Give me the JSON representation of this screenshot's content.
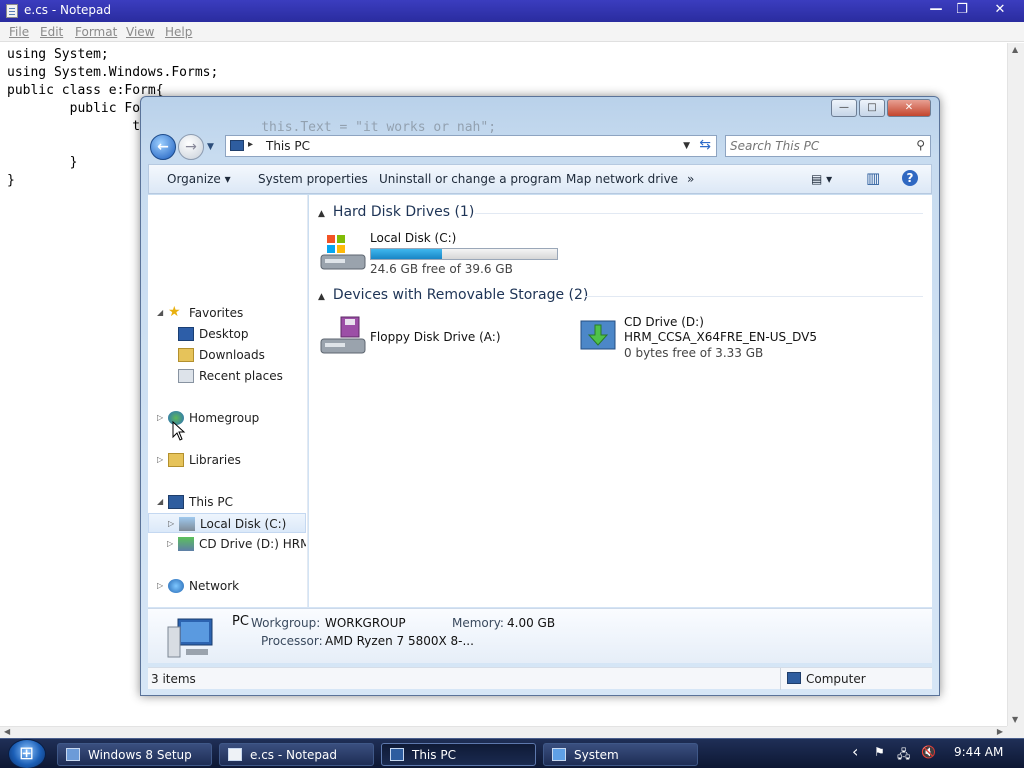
{
  "notepad": {
    "title": "e.cs - Notepad",
    "menu": [
      "File",
      "Edit",
      "Format",
      "View",
      "Help"
    ],
    "code": [
      "using System;",
      "using System.Windows.Forms;",
      "public class e:Form{",
      "        public Form1(){",
      "                this.Text = \"it works or nah\";",
      "",
      "        }",
      "}"
    ],
    "controls": {
      "minimize": "—",
      "maximize": "❐",
      "close": "✕"
    }
  },
  "explorer": {
    "controls": {
      "minimize": "—",
      "maximize": "□",
      "close": "✕"
    },
    "back": "←",
    "forward": "→",
    "address": {
      "separator": "▸",
      "path": "This PC",
      "dropdown": "▼",
      "refresh": "⇆"
    },
    "search": {
      "placeholder": "Search This PC",
      "icon": "⚲"
    },
    "toolbar": {
      "organize": "Organize ▾",
      "system_properties": "System properties",
      "uninstall": "Uninstall or change a program",
      "map_drive": "Map network drive",
      "more": "»",
      "views": "▤ ▾",
      "pane": "▥",
      "help": "?"
    },
    "nav": {
      "favorites": "Favorites",
      "desktop": "Desktop",
      "downloads": "Downloads",
      "recent": "Recent places",
      "homegroup": "Homegroup",
      "libraries": "Libraries",
      "this_pc": "This PC",
      "local_disk": "Local Disk (C:)",
      "cd_drive": "CD Drive (D:) HRM_C",
      "network": "Network",
      "expanded_arrow": "◢",
      "collapsed_arrow": "▷"
    },
    "groups": {
      "hard_disks": "Hard Disk Drives (1)",
      "removable": "Devices with Removable Storage (2)",
      "arrow": "▲"
    },
    "drives": {
      "c": {
        "name": "Local Disk (C:)",
        "free": "24.6 GB free of 39.6 GB",
        "used_fraction": 0.38
      },
      "a": {
        "name": "Floppy Disk Drive (A:)"
      },
      "d": {
        "name": "CD Drive (D:)",
        "label": "HRM_CCSA_X64FRE_EN-US_DV5",
        "free": "0 bytes free of 3.33 GB"
      }
    },
    "details": {
      "pc": "PC",
      "workgroup_label": "Workgroup:",
      "workgroup": "WORKGROUP",
      "memory_label": "Memory:",
      "memory": "4.00 GB",
      "processor_label": "Processor:",
      "processor": "AMD Ryzen 7 5800X 8-..."
    },
    "status": {
      "count": "3 items",
      "zone": "Computer"
    }
  },
  "taskbar": {
    "tasks": [
      "Windows 8 Setup",
      "e.cs - Notepad",
      "This PC",
      "System"
    ],
    "tray": {
      "chevron": "‹",
      "flag": "⚑",
      "network": "🖧",
      "volume": "🔇",
      "time": "9:44 AM"
    }
  },
  "colors": {
    "accent": "#1985c5",
    "title_bar": "#2a2c9f",
    "taskbar": "#0d1733"
  }
}
